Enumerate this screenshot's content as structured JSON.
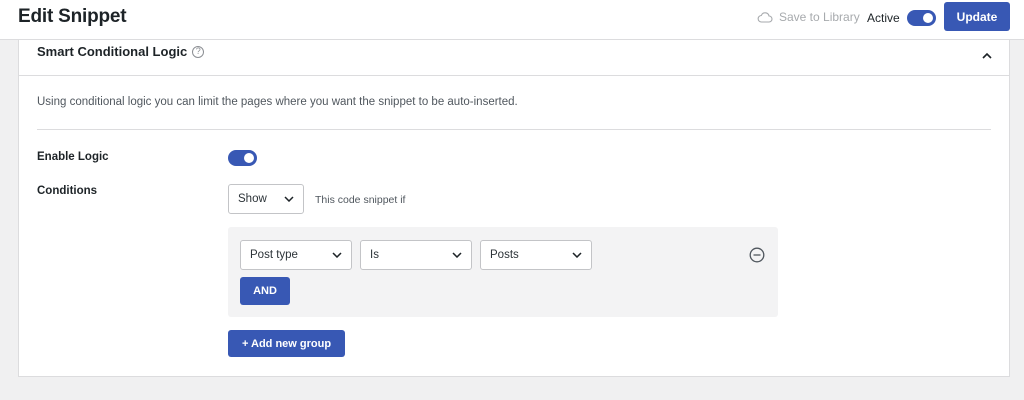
{
  "header": {
    "title": "Edit Snippet",
    "save_to_library": "Save to Library",
    "active_label": "Active",
    "active_on": true,
    "update_label": "Update"
  },
  "panel": {
    "title": "Smart Conditional Logic",
    "help_glyph": "?",
    "description": "Using conditional logic you can limit the pages where you want the snippet to be auto-inserted.",
    "enable_logic_label": "Enable Logic",
    "enable_logic_on": true,
    "conditions_label": "Conditions",
    "show_select": "Show",
    "snippet_if_text": "This code snippet if",
    "group": {
      "condition_field": "Post type",
      "operator": "Is",
      "value": "Posts",
      "and_label": "AND"
    },
    "add_group_label": "+ Add new group"
  },
  "colors": {
    "accent": "#3858b4",
    "background": "#f0f0f1",
    "panel": "#ffffff",
    "border": "#dcdcde"
  },
  "icons": {
    "save": "cloud-icon",
    "help": "help-circle-icon",
    "collapse": "chevron-up-icon",
    "dropdown": "chevron-down-icon",
    "remove_group": "minus-circle-icon"
  }
}
